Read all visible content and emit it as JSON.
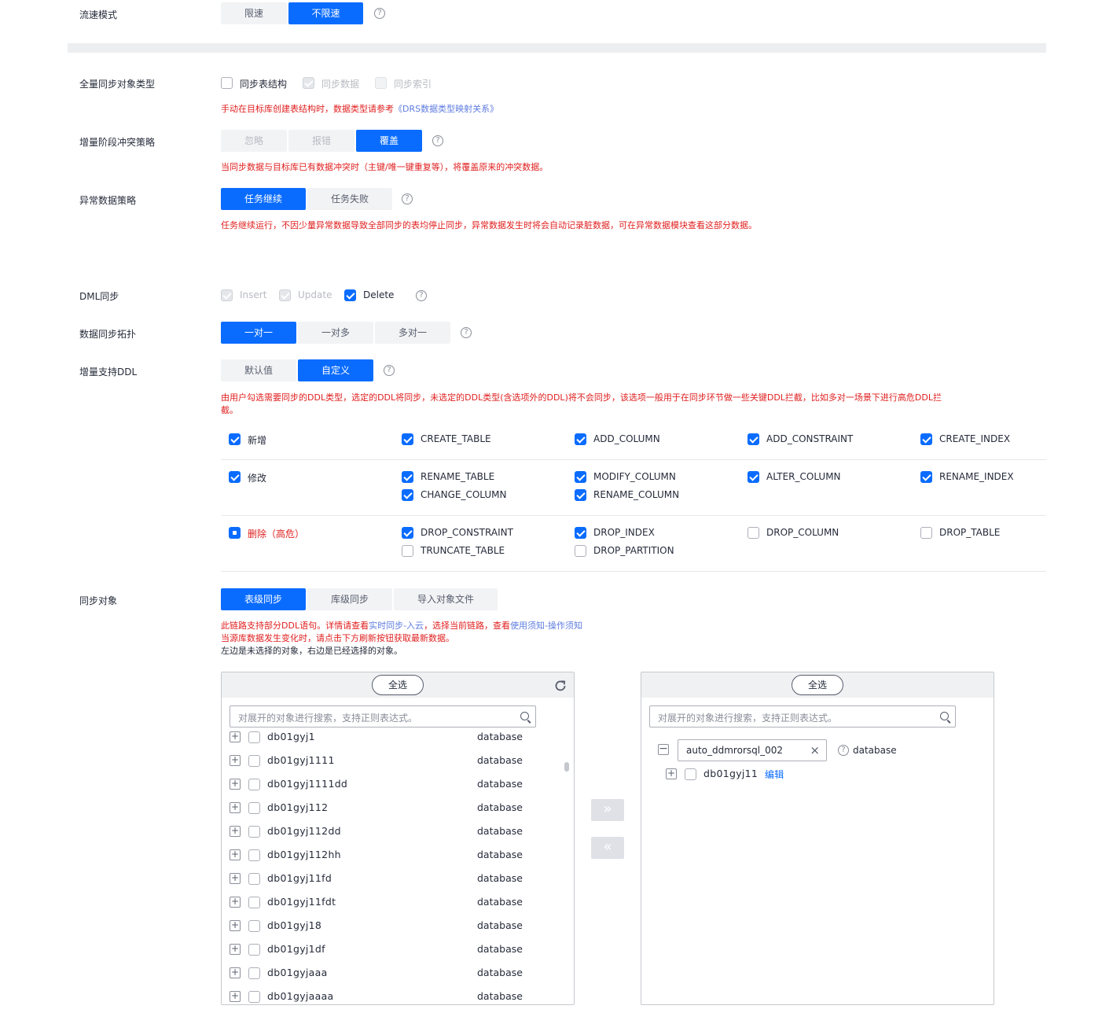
{
  "flow_mode": {
    "label": "流速模式",
    "options": [
      "限速",
      "不限速"
    ],
    "active": "不限速"
  },
  "full_sync_type": {
    "label": "全量同步对象类型",
    "items": [
      {
        "text": "同步表结构",
        "state": "off"
      },
      {
        "text": "同步数据",
        "state": "disabled-on"
      },
      {
        "text": "同步索引",
        "state": "disabled-off"
      }
    ],
    "note_prefix": "手动在目标库创建表结构时，数据类型请参考",
    "note_link": "《DRS数据类型映射关系》"
  },
  "conflict_policy": {
    "label": "增量阶段冲突策略",
    "options": [
      "忽略",
      "报错",
      "覆盖"
    ],
    "active": "覆盖",
    "note": "当同步数据与目标库已有数据冲突时（主键/唯一键重复等），将覆盖原来的冲突数据。"
  },
  "abnormal_policy": {
    "label": "异常数据策略",
    "options": [
      "任务继续",
      "任务失败"
    ],
    "active": "任务继续",
    "note": "任务继续运行，不因少量异常数据导致全部同步的表均停止同步，异常数据发生时将会自动记录脏数据，可在异常数据模块查看这部分数据。"
  },
  "dml_sync": {
    "label": "DML同步",
    "items": [
      {
        "text": "Insert",
        "state": "disabled-on"
      },
      {
        "text": "Update",
        "state": "disabled-on"
      },
      {
        "text": "Delete",
        "state": "on"
      }
    ]
  },
  "topology": {
    "label": "数据同步拓扑",
    "options": [
      "一对一",
      "一对多",
      "多对一"
    ],
    "active": "一对一"
  },
  "ddl_support": {
    "label": "增量支持DDL",
    "options": [
      "默认值",
      "自定义"
    ],
    "active": "自定义",
    "note_line1": "由用户勾选需要同步的DDL类型，选定的DDL将同步，未选定的DDL类型(含选项外的DDL)将不会同步，该选项一般用于在同步环节做一些关键DDL拦截，比如多对一场景下进行高危DDL拦",
    "note_line2": "截。",
    "groups": {
      "add": {
        "label": "新增",
        "state": "on",
        "items": [
          "CREATE_TABLE",
          "ADD_COLUMN",
          "ADD_CONSTRAINT",
          "CREATE_INDEX"
        ]
      },
      "modify": {
        "label": "修改",
        "state": "on",
        "items": [
          "RENAME_TABLE",
          "CHANGE_COLUMN",
          "MODIFY_COLUMN",
          "RENAME_COLUMN",
          "ALTER_COLUMN",
          "RENAME_INDEX"
        ]
      },
      "delete": {
        "label": "删除（高危）",
        "state": "partial",
        "items": [
          "DROP_CONSTRAINT",
          "TRUNCATE_TABLE",
          "DROP_INDEX",
          "DROP_PARTITION",
          "DROP_COLUMN",
          "DROP_TABLE"
        ]
      }
    }
  },
  "sync_objects": {
    "label": "同步对象",
    "options": [
      "表级同步",
      "库级同步",
      "导入对象文件"
    ],
    "active": "表级同步",
    "note1_prefix": "此链路支持部分DDL语句。详情请查看",
    "note1_link1": "实时同步-入云",
    "note1_mid": "，选择当前链路，查看",
    "note1_link2": "使用须知-操作须知",
    "note2": "当源库数据发生变化时，请点击下方刷新按钮获取最新数据。",
    "note3": "左边是未选择的对象，右边是已经选择的对象。"
  },
  "left_panel": {
    "select_all": "全选",
    "search_placeholder": "对展开的对象进行搜索，支持正则表达式。",
    "rows": [
      {
        "name": "db01gyj1",
        "type": "database"
      },
      {
        "name": "db01gyj1111",
        "type": "database"
      },
      {
        "name": "db01gyj1111dd",
        "type": "database"
      },
      {
        "name": "db01gyj112",
        "type": "database"
      },
      {
        "name": "db01gyj112dd",
        "type": "database"
      },
      {
        "name": "db01gyj112hh",
        "type": "database"
      },
      {
        "name": "db01gyj11fd",
        "type": "database"
      },
      {
        "name": "db01gyj11fdt",
        "type": "database"
      },
      {
        "name": "db01gyj18",
        "type": "database"
      },
      {
        "name": "db01gyj1df",
        "type": "database"
      },
      {
        "name": "db01gyjaaa",
        "type": "database"
      },
      {
        "name": "db01gyjaaaa",
        "type": "database"
      }
    ]
  },
  "right_panel": {
    "select_all": "全选",
    "search_placeholder": "对展开的对象进行搜索，支持正则表达式。",
    "target_db": "auto_ddmrorsql_002",
    "target_type": "database",
    "child_name": "db01gyj11",
    "child_action": "编辑"
  },
  "colors": {
    "primary": "#0a6cff",
    "danger": "#e02020",
    "link": "#5e7ce0"
  }
}
